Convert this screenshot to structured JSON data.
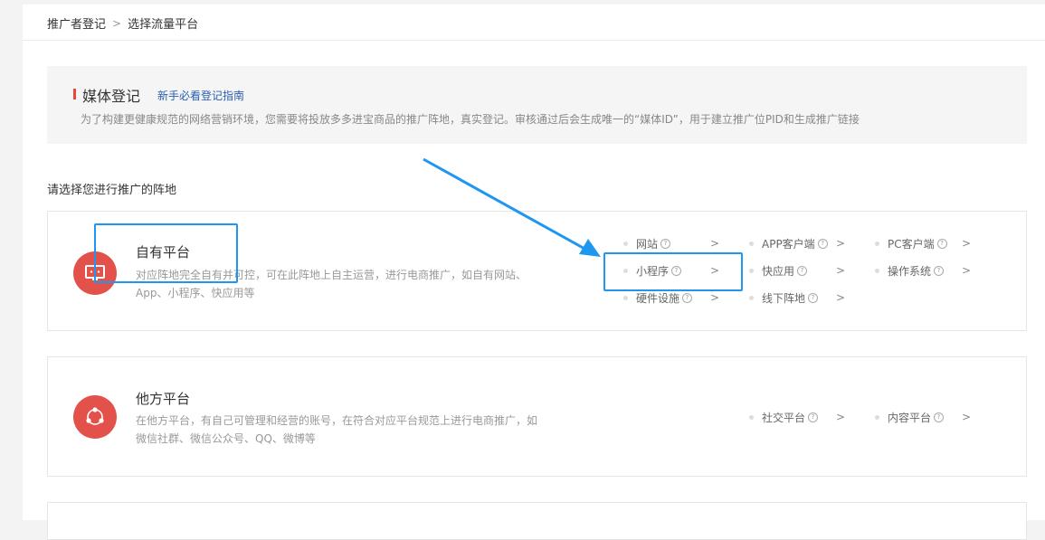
{
  "breadcrumb": {
    "item1": "推广者登记",
    "separator": ">",
    "item2": "选择流量平台"
  },
  "notice": {
    "title": "媒体登记",
    "guide_link": "新手必看登记指南",
    "description": "为了构建更健康规范的网络营销环境，您需要将投放多多进宝商品的推广阵地，真实登记。审核通过后会生成唯一的“媒体ID”，用于建立推广位PID和生成推广链接"
  },
  "prompt": "请选择您进行推广的阵地",
  "own_platform": {
    "title": "自有平台",
    "desc_line1": "对应阵地完全自有并可控，可在此阵地上自主运营，进行电商推广，如自有网站、",
    "desc_line2": "App、小程序、快应用等",
    "options": [
      "网站",
      "APP客户端",
      "PC客户端",
      "小程序",
      "快应用",
      "操作系统",
      "硬件设施",
      "线下阵地"
    ]
  },
  "other_platform": {
    "title": "他方平台",
    "desc_line1": "在他方平台，有自己可管理和经营的账号，在符合对应平台规范上进行电商推广，如",
    "desc_line2": "微信社群、微信公众号、QQ、微博等",
    "options": [
      "社交平台",
      "内容平台"
    ]
  },
  "icons": {
    "help": "question-circle-icon",
    "chevron": "chevron-right-icon",
    "own_platform": "monitor-icon",
    "other_platform": "share-network-icon"
  },
  "colors": {
    "accent_red": "#e3524a",
    "link_blue": "#2a5db0",
    "annotation_blue": "#1e97f2"
  }
}
